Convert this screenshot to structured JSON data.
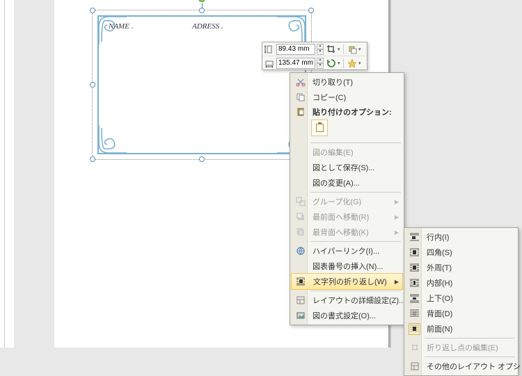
{
  "shape": {
    "label_name": "NAME .",
    "label_address": "ADRESS ."
  },
  "size_toolbar": {
    "height_value": "89.43 mm",
    "width_value": "135.47 mm"
  },
  "context_menu": {
    "cut": "切り取り(T)",
    "copy": "コピー(C)",
    "paste_options_label": "貼り付けのオプション:",
    "edit_picture": "図の編集(E)",
    "save_as_picture": "図として保存(S)...",
    "change_picture": "図の変更(A)...",
    "group": "グループ化(G)",
    "bring_front": "最前面へ移動(R)",
    "send_back": "最背面へ移動(K)",
    "hyperlink": "ハイパーリンク(I)...",
    "caption": "図表番号の挿入(N)...",
    "text_wrap": "文字列の折り返し(W)",
    "layout_detail": "レイアウトの詳細設定(Z)...",
    "format_picture": "図の書式設定(O)..."
  },
  "wrap_submenu": {
    "inline": "行内(I)",
    "square": "四角(S)",
    "tight": "外周(T)",
    "through": "内部(H)",
    "topbottom": "上下(O)",
    "behind": "背面(D)",
    "front": "前面(N)",
    "edit_points": "折り返し点の編集(E)",
    "more": "その他のレイアウト オプション(L)..."
  }
}
